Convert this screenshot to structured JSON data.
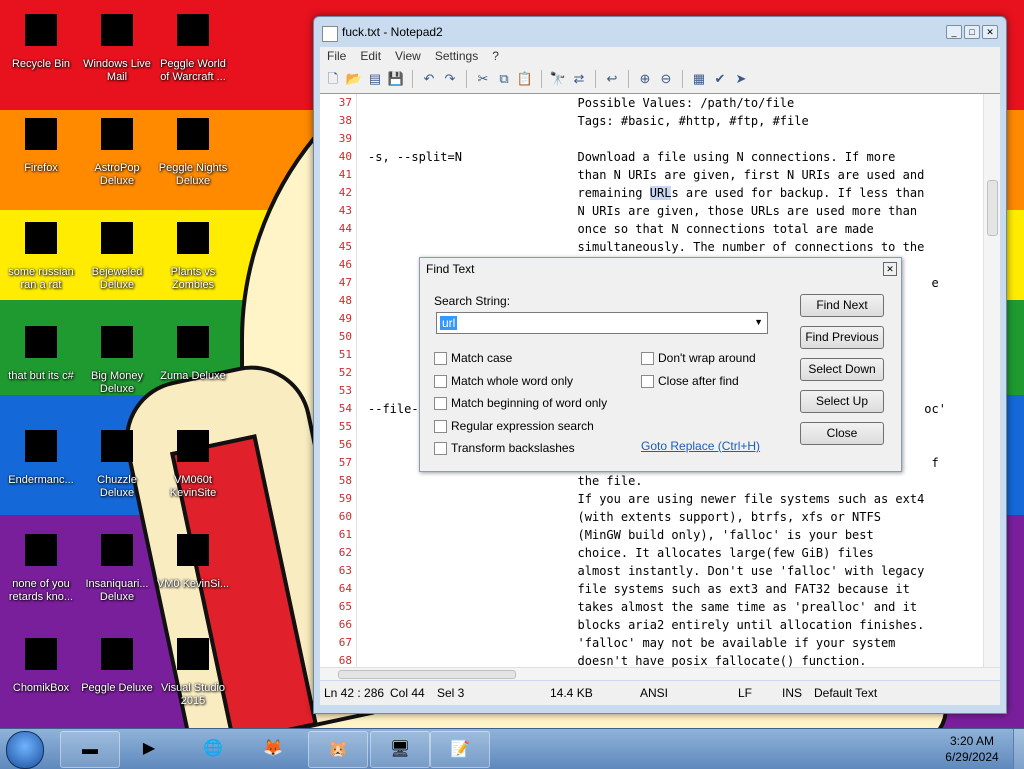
{
  "desktop": {
    "icons": [
      {
        "label": "Recycle Bin",
        "icon": "recycle-bin-icon"
      },
      {
        "label": "Windows Live Mail",
        "icon": "mail-icon"
      },
      {
        "label": "Peggle World of Warcraft ...",
        "icon": "peggle-icon"
      },
      {
        "label": "Firefox",
        "icon": "firefox-icon"
      },
      {
        "label": "AstroPop Deluxe",
        "icon": "game-icon"
      },
      {
        "label": "Peggle Nights Deluxe",
        "icon": "peggle-icon"
      },
      {
        "label": "some russian ran a rat",
        "icon": "file-icon"
      },
      {
        "label": "Bejeweled Deluxe",
        "icon": "gem-icon"
      },
      {
        "label": "Plants vs Zombies",
        "icon": "plant-icon"
      },
      {
        "label": "that but its c#",
        "icon": "shortcut-icon"
      },
      {
        "label": "Big Money Deluxe",
        "icon": "money-bag-icon"
      },
      {
        "label": "Zuma Deluxe",
        "icon": "zuma-icon"
      },
      {
        "label": "Endermanc...",
        "icon": "window-icon"
      },
      {
        "label": "Chuzzle Deluxe",
        "icon": "chuzzle-icon"
      },
      {
        "label": "VM060t KevinSite",
        "icon": "vm-icon"
      },
      {
        "label": "none of you retards kno...",
        "icon": "peggle-icon"
      },
      {
        "label": "Insaniquari... Deluxe",
        "icon": "fish-icon"
      },
      {
        "label": "VM0 KevinSi...",
        "icon": "vm-icon"
      },
      {
        "label": "ChomikBox",
        "icon": "chomikbox-icon"
      },
      {
        "label": "Peggle Deluxe",
        "icon": "peggle-icon"
      },
      {
        "label": "Visual Studio 2015",
        "icon": "visual-studio-icon"
      }
    ]
  },
  "notepad": {
    "title": "fuck.txt - Notepad2",
    "menu": [
      "File",
      "Edit",
      "View",
      "Settings",
      "?"
    ],
    "line_numbers": [
      "37",
      "38",
      "39",
      "40",
      "41",
      "42",
      "43",
      "44",
      "45",
      "46",
      "47",
      "48",
      "49",
      "50",
      "51",
      "52",
      "53",
      "54",
      "55",
      "56",
      "57",
      "58",
      "59",
      "60",
      "61",
      "62",
      "63",
      "64",
      "65",
      "66",
      "67",
      "68"
    ],
    "lines": [
      "                             Possible Values: /path/to/file",
      "                             Tags: #basic, #http, #ftp, #file",
      "",
      "-s, --split=N                Download a file using N connections. If more",
      "                             than N URIs are given, first N URIs are used and",
      "                             remaining URLs are used for backup. If less than",
      "                             N URIs are given, those URLs are used more than",
      "                             once so that N connections total are made",
      "                             simultaneously. The number of connections to the",
      "",
      "                                                                              e",
      "",
      "",
      "",
      "",
      "",
      "",
      "--file-                                                                      oc'",
      "",
      "",
      "                                                                              f",
      "                             the file.",
      "                             If you are using newer file systems such as ext4",
      "                             (with extents support), btrfs, xfs or NTFS",
      "                             (MinGW build only), 'falloc' is your best",
      "                             choice. It allocates large(few GiB) files",
      "                             almost instantly. Don't use 'falloc' with legacy",
      "                             file systems such as ext3 and FAT32 because it",
      "                             takes almost the same time as 'prealloc' and it",
      "                             blocks aria2 entirely until allocation finishes.",
      "                             'falloc' may not be available if your system",
      "                             doesn't have posix_fallocate() function."
    ],
    "status": {
      "position": "Ln 42 : 286",
      "col": "Col 44",
      "sel": "Sel 3",
      "size": "14.4 KB",
      "encoding": "ANSI",
      "eol": "LF",
      "mode": "INS",
      "scheme": "Default Text"
    }
  },
  "find_dialog": {
    "title": "Find Text",
    "search_label": "Search String:",
    "search_value": "url",
    "options_left": [
      "Match case",
      "Match whole word only",
      "Match beginning of word only",
      "Regular expression search",
      "Transform backslashes"
    ],
    "options_right": [
      "Don't wrap around",
      "Close after find"
    ],
    "goto_replace": "Goto Replace (Ctrl+H)",
    "buttons": [
      "Find Next",
      "Find Previous",
      "Select Down",
      "Select Up",
      "Close"
    ]
  },
  "taskbar": {
    "time": "3:20 AM",
    "date": "6/29/2024",
    "items": [
      "window-icon",
      "media-player-icon",
      "globe-icon",
      "firefox-icon",
      "chomikbox-icon",
      "monitor-icon",
      "notepad-icon"
    ]
  },
  "colors": {
    "gutter_numbers": "#cc2b2b",
    "selection": "#c6d8f1",
    "link": "#1a5fb4"
  }
}
